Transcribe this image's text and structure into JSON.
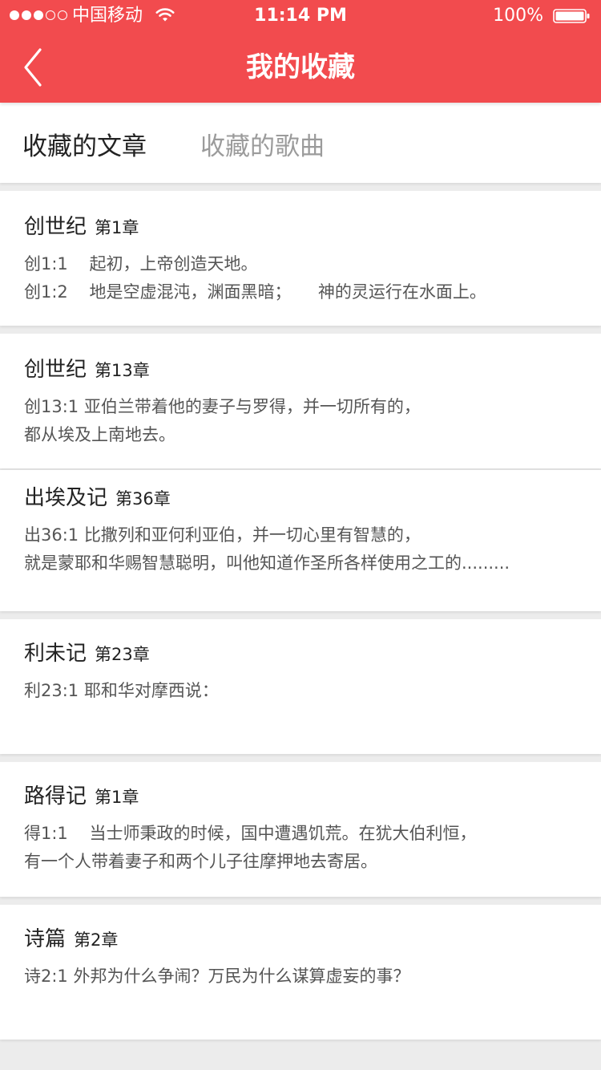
{
  "status_bar": {
    "carrier": "中国移动",
    "time": "11:14 PM",
    "battery": "100%"
  },
  "nav": {
    "title": "我的收藏"
  },
  "tabs": [
    {
      "label": "收藏的文章",
      "active": true
    },
    {
      "label": "收藏的歌曲",
      "active": false
    }
  ],
  "favorites": [
    {
      "book": "创世纪",
      "chapter": "第1章",
      "lines": [
        "创1:1    起初，上帝创造天地。",
        "创1:2    地是空虚混沌，渊面黑暗；     神的灵运行在水面上。"
      ]
    },
    {
      "book": "创世纪",
      "chapter": "第13章",
      "lines": [
        "创13:1 亚伯兰带着他的妻子与罗得，并一切所有的，",
        "都从埃及上南地去。"
      ]
    },
    {
      "book": "出埃及记",
      "chapter": "第36章",
      "lines": [
        "出36:1 比撒列和亚何利亚伯，并一切心里有智慧的，",
        "就是蒙耶和华赐智慧聪明，叫他知道作圣所各样使用之工的........."
      ]
    },
    {
      "book": "利未记",
      "chapter": "第23章",
      "lines": [
        "利23:1 耶和华对摩西说：",
        ""
      ]
    },
    {
      "book": "路得记",
      "chapter": "第1章",
      "lines": [
        "得1:1    当士师秉政的时候，国中遭遇饥荒。在犹大伯利恒，",
        "有一个人带着妻子和两个儿子往摩押地去寄居。"
      ]
    },
    {
      "book": "诗篇",
      "chapter": "第2章",
      "lines": [
        "诗2:1 外邦为什么争闹？万民为什么谋算虚妄的事？",
        ""
      ]
    }
  ],
  "colors": {
    "accent": "#f24b4e",
    "background": "#ececec",
    "tab_inactive": "#9b9b9b"
  }
}
